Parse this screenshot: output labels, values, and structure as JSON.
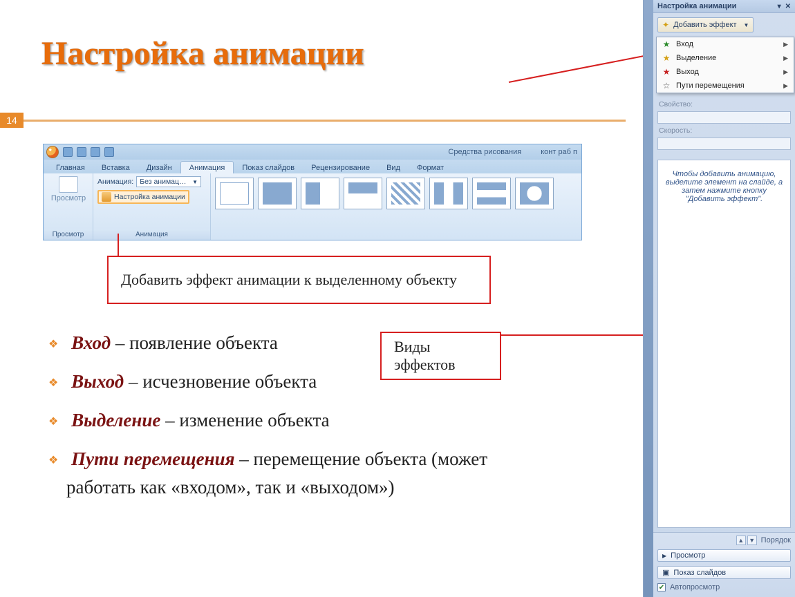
{
  "slide": {
    "title": "Настройка анимации",
    "number": "14"
  },
  "ribbon": {
    "context_title": "Средства рисования",
    "doc_title": "конт раб п",
    "tabs": [
      "Главная",
      "Вставка",
      "Дизайн",
      "Анимация",
      "Показ слайдов",
      "Рецензирование",
      "Вид",
      "Формат"
    ],
    "active_tab_index": 3,
    "group_preview": "Просмотр",
    "preview_btn": "Просмотр",
    "group_animation": "Анимация",
    "anim_label": "Анимация:",
    "anim_value": "Без анимац…",
    "anim_setup": "Настройка анимации"
  },
  "callouts": {
    "add_effect": "Добавить эффект анимации к выделенному объекту",
    "effects_kinds": "Виды эффектов"
  },
  "effects": [
    {
      "term": "Вход",
      "desc": " – появление объекта"
    },
    {
      "term": "Выход",
      "desc": " – исчезновение объекта"
    },
    {
      "term": "Выделение",
      "desc": " – изменение объекта"
    },
    {
      "term": "Пути перемещения",
      "desc": " – перемещение объекта (может работать как «входом», так и «выходом»)"
    }
  ],
  "taskpane": {
    "title": "Настройка анимации",
    "add_effect_btn": "Добавить эффект",
    "menu": [
      {
        "star": "s-green",
        "label": "Вход"
      },
      {
        "star": "s-yellow",
        "label": "Выделение"
      },
      {
        "star": "s-red",
        "label": "Выход"
      },
      {
        "star": "s-out",
        "label": "Пути перемещения"
      }
    ],
    "labels": {
      "property": "Свойство:",
      "speed": "Скорость:"
    },
    "hint": "Чтобы добавить анимацию, выделите элемент на слайде, а затем нажмите кнопку \"Добавить эффект\".",
    "reorder": "Порядок",
    "preview": "Просмотр",
    "slideshow": "Показ слайдов",
    "autopreview": "Автопросмотр"
  }
}
